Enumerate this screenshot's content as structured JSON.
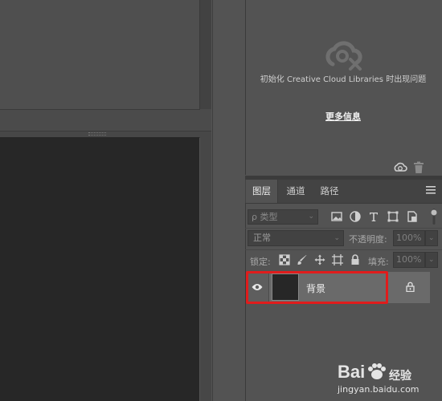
{
  "libraries": {
    "message": "初始化 Creative Cloud Libraries 时出现问题",
    "more_info": "更多信息",
    "cloud_icon": "cloud-error-icon",
    "sync_icon": "cloud-sync-icon",
    "trash_icon": "trash-icon"
  },
  "layers_panel": {
    "tabs": [
      {
        "label": "图层",
        "active": true
      },
      {
        "label": "通道",
        "active": false
      },
      {
        "label": "路径",
        "active": false
      }
    ],
    "filter": {
      "label": "ρ 类型",
      "icons": [
        "image-filter-icon",
        "adjustment-filter-icon",
        "type-filter-icon",
        "shape-filter-icon",
        "smart-object-filter-icon"
      ]
    },
    "blend_mode": "正常",
    "opacity_label": "不透明度:",
    "opacity_value": "100%",
    "lock_label": "锁定:",
    "lock_icons": [
      "lock-transparent-icon",
      "lock-image-icon",
      "lock-position-icon",
      "lock-artboard-icon",
      "lock-all-icon"
    ],
    "fill_label": "填充:",
    "fill_value": "100%",
    "layers": [
      {
        "name": "背景",
        "visible": true,
        "locked": true,
        "selected": true
      }
    ]
  },
  "highlight_color": "#e01c1c",
  "watermark": {
    "brand": "Bai",
    "brand_sub": "经验",
    "url": "jingyan.baidu.com"
  }
}
